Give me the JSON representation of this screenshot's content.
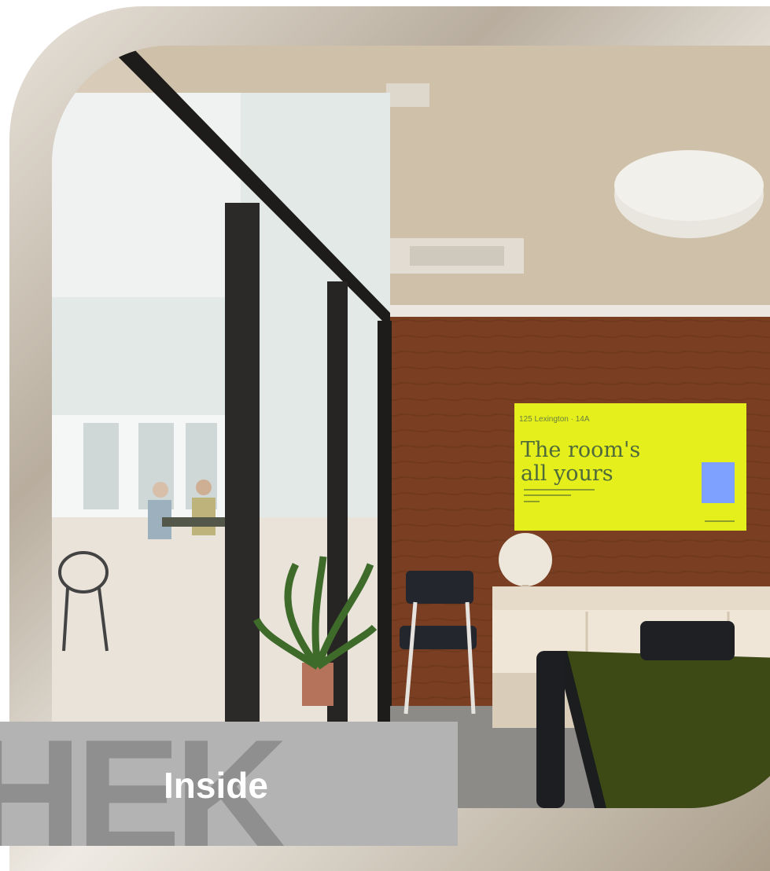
{
  "caption": {
    "title": "Inside",
    "watermark": "HEK"
  },
  "screen": {
    "location": "125 Lexington · 14A",
    "line1": "The room's",
    "line2": "all yours"
  },
  "colors": {
    "caption_bg": "#b3b3b3",
    "screen_bg": "#e4ef1c",
    "wall": "#7a3f22",
    "frame_metal": "#b8ad9e"
  }
}
